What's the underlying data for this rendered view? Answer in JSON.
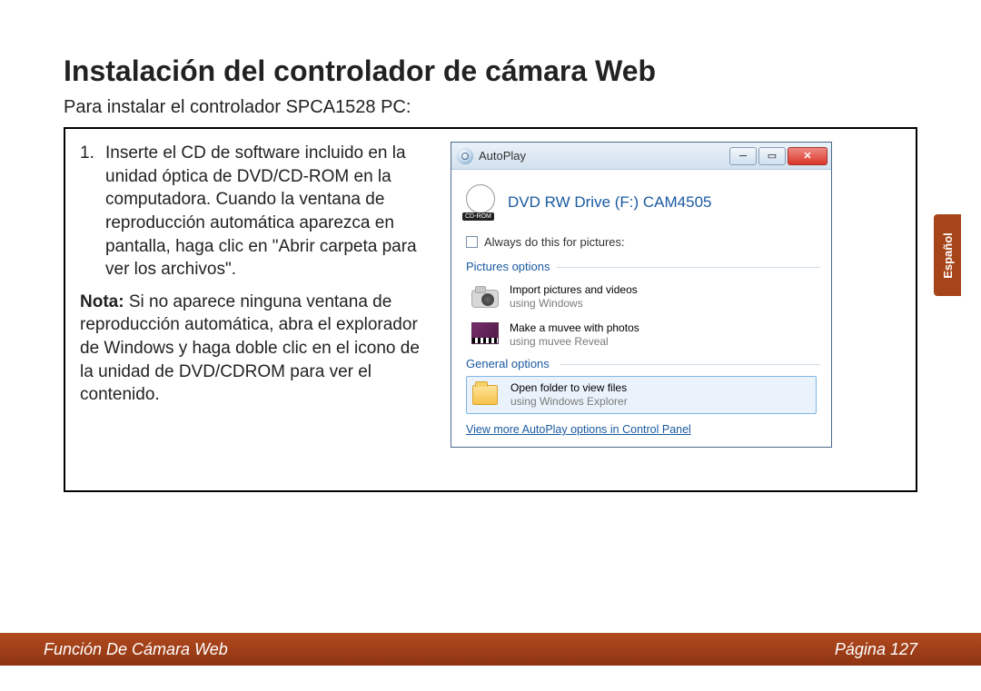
{
  "heading": "Instalación del controlador de cámara Web",
  "subtitle": "Para instalar el controlador SPCA1528 PC:",
  "step": {
    "num": "1.",
    "text": "Inserte el CD de software inclu­ido en la unidad óptica de DVD/CD-ROM en la computadora. Cu­ando la ventana de reproducción automática aparezca en pantalla, haga clic en \"Abrir carpeta para ver los archivos\"."
  },
  "note": {
    "label": "Nota:",
    "text": " Si no aparece ninguna ven­tana de reproducción automática, abra el explorador de Windows y haga doble clic en el icono de la unidad de DVD/CDROM para ver el contenido."
  },
  "autoplay": {
    "title": "AutoPlay",
    "drive": "DVD RW Drive (F:) CAM4505",
    "cd_tag": "CD-ROM",
    "always": "Always do this for pictures:",
    "pictures_label": "Pictures options",
    "general_label": "General options",
    "opt1": {
      "title": "Import pictures and videos",
      "sub": "using Windows"
    },
    "opt2": {
      "title": "Make a muvee with photos",
      "sub": "using muvee Reveal"
    },
    "opt3": {
      "title": "Open folder to view files",
      "sub": "using Windows Explorer"
    },
    "view_more": "View more AutoPlay options in Control Panel"
  },
  "side_tab": "Español",
  "footer": {
    "left": "Función De Cámara Web",
    "right": "Página 127"
  }
}
